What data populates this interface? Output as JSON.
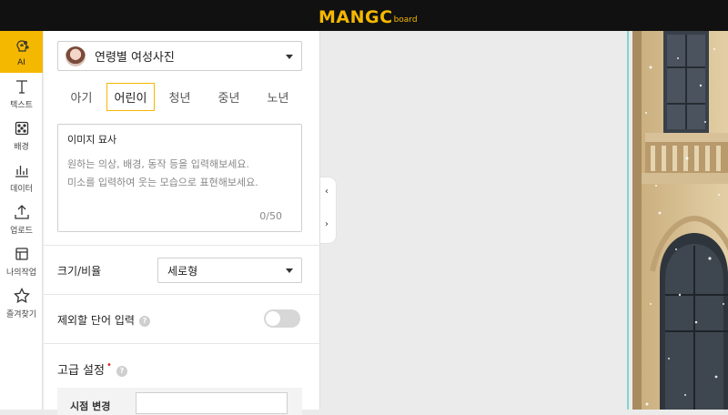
{
  "app": {
    "logo_main": "MANGC",
    "logo_sub": "board"
  },
  "rail": {
    "items": [
      {
        "label": "AI",
        "icon": "ai-brain-icon",
        "active": true
      },
      {
        "label": "텍스트",
        "icon": "text-icon"
      },
      {
        "label": "배경",
        "icon": "background-dice-icon"
      },
      {
        "label": "데이터",
        "icon": "data-chart-icon"
      },
      {
        "label": "업로드",
        "icon": "upload-icon"
      },
      {
        "label": "나의작업",
        "icon": "my-work-icon"
      },
      {
        "label": "즐겨찾기",
        "icon": "star-icon"
      }
    ]
  },
  "panel": {
    "model_select": {
      "value": "연령별 여성사진",
      "icon": "avatar-thumbnail"
    },
    "age_tabs": [
      {
        "label": "아기"
      },
      {
        "label": "어린이",
        "active": true
      },
      {
        "label": "청년"
      },
      {
        "label": "중년"
      },
      {
        "label": "노년"
      }
    ],
    "prompt": {
      "title": "이미지 묘사",
      "placeholder": "원하는 의상, 배경, 동작 등을 입력해보세요.\n미소를 입력하여 웃는 모습으로 표현해보세요.",
      "counter": "0/50"
    },
    "ratio": {
      "label": "크기/비율",
      "value": "세로형"
    },
    "exclude": {
      "label": "제외할 단어 입력",
      "help": "?",
      "toggle_on": false
    },
    "advanced": {
      "label": "고급 설정",
      "required_mark": "•",
      "help": "?",
      "sub_label": "시점 변경",
      "input_value": ""
    }
  },
  "colors": {
    "accent": "#f5b800",
    "topbar": "#111111",
    "guide": "#7fd6cf"
  }
}
